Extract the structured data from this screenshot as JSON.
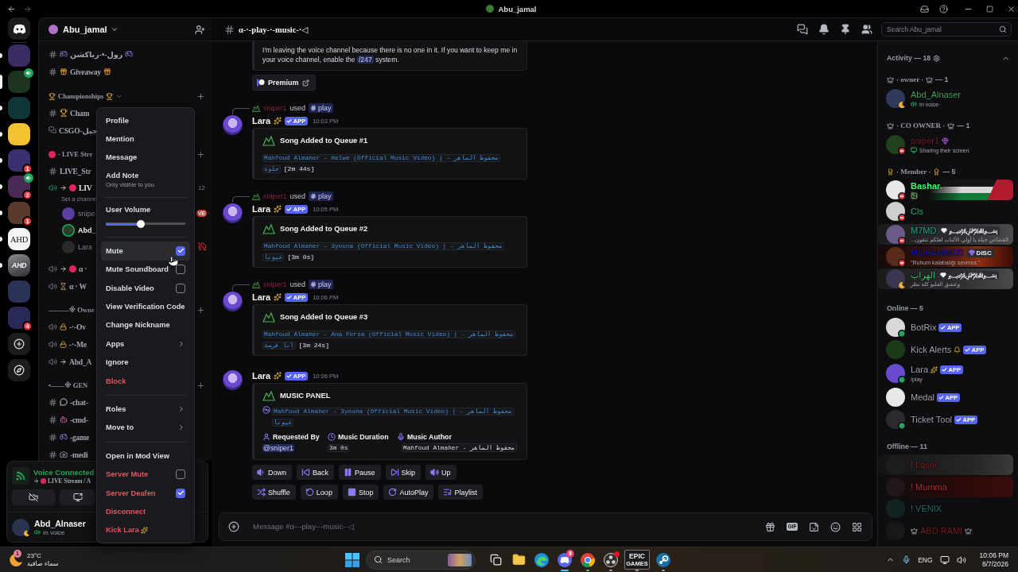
{
  "titlebar": {
    "title": "Abu_jamal"
  },
  "servers": [
    {
      "kind": "image",
      "selected": false,
      "unread": true
    },
    {
      "kind": "image",
      "selected": true,
      "voice": true
    },
    {
      "kind": "image",
      "selected": false,
      "unread": true
    },
    {
      "kind": "image",
      "selected": false,
      "unread": true
    },
    {
      "kind": "image",
      "selected": false,
      "unread": true,
      "badge": "1"
    },
    {
      "kind": "image",
      "selected": false,
      "unread": true,
      "badge": "2",
      "voice": true
    },
    {
      "kind": "image",
      "selected": false,
      "unread": true,
      "badge": "1"
    },
    {
      "kind": "text",
      "label": "AHD",
      "selected": false,
      "unread": true
    },
    {
      "kind": "logo",
      "label": "AHD",
      "selected": false,
      "unread": true
    },
    {
      "kind": "image",
      "selected": false,
      "unread": false
    },
    {
      "kind": "image",
      "selected": false,
      "unread": false,
      "badge": "4"
    },
    {
      "kind": "add",
      "selected": false,
      "unread": false
    },
    {
      "kind": "discover",
      "selected": false,
      "unread": false
    }
  ],
  "sidebar": {
    "server_name": "Abu_jamal",
    "channels": [
      {
        "kind": "text",
        "lead": [
          {
            "kind": "gamepad"
          }
        ],
        "name": "رول-•-رياكشن",
        "trail": [
          {
            "kind": "gamepad"
          }
        ]
      },
      {
        "kind": "text",
        "lead": [
          {
            "kind": "gift"
          }
        ],
        "name": "Giveaway",
        "trail": [
          {
            "kind": "gift"
          }
        ]
      },
      {
        "kind": "category",
        "lead": [
          {
            "kind": "trophy"
          }
        ],
        "name": "Championships",
        "trail": [
          {
            "kind": "trophy"
          }
        ],
        "chevron": true,
        "add": true
      },
      {
        "kind": "text",
        "lead": [
          {
            "kind": "trophy"
          }
        ],
        "name": "Cham"
      },
      {
        "kind": "thread",
        "name": "CSGO-جيل"
      },
      {
        "kind": "category",
        "lead": [
          {
            "kind": "red-dot"
          }
        ],
        "name": "· LIVE Stre",
        "add": true
      },
      {
        "kind": "text",
        "name": "LIVE_Str"
      },
      {
        "kind": "voice",
        "active": true,
        "lead": [
          {
            "kind": "arrow"
          },
          {
            "kind": "red-dot"
          }
        ],
        "name": "LIV",
        "limit": "12",
        "topic": "Set a channe"
      },
      {
        "kind": "user",
        "name": "snipe",
        "live": "VE",
        "speaking": false,
        "deafened": false
      },
      {
        "kind": "user",
        "name": "Abd_",
        "speaking": true,
        "deafened": false
      },
      {
        "kind": "user",
        "name": "Lara",
        "speaking": false,
        "deafened": true
      },
      {
        "kind": "voice",
        "active": false,
        "lead": [
          {
            "kind": "arrow"
          },
          {
            "kind": "red-dot"
          }
        ],
        "name": "α ·"
      },
      {
        "kind": "voice",
        "active": false,
        "lead": [
          {
            "kind": "hourglass"
          }
        ],
        "name": "α · W"
      },
      {
        "kind": "category",
        "name": "———※ Owne",
        "add": true
      },
      {
        "kind": "voice",
        "active": false,
        "lead": [
          {
            "kind": "lock"
          }
        ],
        "name": "-·-Ov"
      },
      {
        "kind": "voice",
        "active": false,
        "lead": [
          {
            "kind": "lock"
          }
        ],
        "name": "-·-Me"
      },
      {
        "kind": "voice",
        "active": false,
        "lead": [
          {
            "kind": "arrow"
          }
        ],
        "name": "Abd_A"
      },
      {
        "kind": "category",
        "name": "•——※ GEN",
        "add": true
      },
      {
        "kind": "text",
        "lead": [
          {
            "kind": "speech"
          }
        ],
        "name": "-chat-"
      },
      {
        "kind": "text",
        "lead": [
          {
            "kind": "robot"
          }
        ],
        "name": "-cmd-"
      },
      {
        "kind": "text",
        "lead": [
          {
            "kind": "gamepad"
          }
        ],
        "name": "-game"
      },
      {
        "kind": "text",
        "lead": [
          {
            "kind": "camera"
          }
        ],
        "name": "-medi"
      }
    ]
  },
  "voice_panel": {
    "status": "Voice Connected",
    "lead": [
      {
        "kind": "arrow"
      },
      {
        "kind": "red-dot"
      }
    ],
    "channel": "LIVE Stream / A"
  },
  "user_panel": {
    "name": "Abd_Alnaser",
    "status": {
      "kind": "idle"
    },
    "activity": "In voice"
  },
  "channel_header": {
    "name": "α-·-play-·-music-·◁"
  },
  "search": {
    "placeholder": "Search Abu_jamal"
  },
  "messages": [
    {
      "kind": "embed-tail",
      "before": "I'm leaving the voice channel because there is no one in it. If you want to keep me in your voice channel, enable the ",
      "command": "/247",
      "after": " system."
    },
    {
      "kind": "link-button",
      "label": "Premium"
    },
    {
      "kind": "bot",
      "reply": {
        "user": "sniper1",
        "verb": "used",
        "command": "play"
      },
      "author": "Lara",
      "trail": [
        {
          "kind": "sparkle"
        }
      ],
      "app": "APP",
      "time": "10:03 PM",
      "embed": {
        "kind": "queue",
        "title": "Song Added to Queue #1",
        "track": "Mahfoud Almaher - Helwe (Official Music Video) | محفوظ الماهر - حلوة",
        "duration": "[2m 44s]"
      }
    },
    {
      "kind": "bot",
      "reply": {
        "user": "sniper1",
        "verb": "used",
        "command": "play"
      },
      "author": "Lara",
      "trail": [
        {
          "kind": "sparkle"
        }
      ],
      "app": "APP",
      "time": "10:05 PM",
      "embed": {
        "kind": "queue",
        "title": "Song Added to Queue #2",
        "track": "Mahfoud Almaher - 3youna (Official Music Video) | محفوظ الماهر - عيونا",
        "duration": "[3m 0s]"
      }
    },
    {
      "kind": "bot",
      "reply": {
        "user": "sniper1",
        "verb": "used",
        "command": "play"
      },
      "author": "Lara",
      "trail": [
        {
          "kind": "sparkle"
        }
      ],
      "app": "APP",
      "time": "10:06 PM",
      "embed": {
        "kind": "queue",
        "title": "Song Added to Queue #3",
        "track": "Mahfoud Almaher - Ana Forsa (Official Music Video) | محفوظ الماهر - انا فرصة",
        "duration": "[3m 24s]"
      }
    },
    {
      "kind": "bot",
      "author": "Lara",
      "trail": [
        {
          "kind": "sparkle"
        }
      ],
      "app": "APP",
      "time": "10:06 PM",
      "embed": {
        "kind": "panel",
        "title": "MUSIC PANEL",
        "track": "Mahfoud Almaher - 3youna (Official Music Video) | محفوظ الماهر - عيونا",
        "fields": [
          {
            "kind": "mention",
            "name": "Requested By",
            "value": "@sniper1"
          },
          {
            "kind": "code",
            "name": "Music Duration",
            "value": "3m 0s"
          },
          {
            "kind": "code",
            "name": "Music Author",
            "value": "Mahfoud Almaher - محفوظ الماهر"
          }
        ]
      },
      "buttons": [
        [
          {
            "kind": "down",
            "label": "Down"
          },
          {
            "kind": "back",
            "label": "Back"
          },
          {
            "kind": "pause",
            "label": "Pause"
          },
          {
            "kind": "skip",
            "label": "Skip"
          },
          {
            "kind": "up",
            "label": "Up"
          }
        ],
        [
          {
            "kind": "shuffle",
            "label": "Shuffle"
          },
          {
            "kind": "loop",
            "label": "Loop"
          },
          {
            "kind": "stop",
            "label": "Stop"
          },
          {
            "kind": "autoplay",
            "label": "AutoPlay"
          },
          {
            "kind": "playlist",
            "label": "Playlist"
          }
        ]
      ]
    }
  ],
  "composer": {
    "placeholder": "Message #α-·-play-·-music-·◁",
    "gif": "GIF"
  },
  "members": {
    "activity": {
      "title": "Activity — 18"
    },
    "groups": [
      {
        "kind": "role",
        "title": "· owner ·",
        "count": "— 1",
        "icon": {
          "kind": "crown"
        },
        "members": [
          {
            "name": "Abd_Alnaser",
            "color": "#3ba55c",
            "status": {
              "kind": "idle"
            },
            "activity": {
              "kind": "voice",
              "text": "In voice"
            }
          }
        ]
      },
      {
        "kind": "role",
        "title": "· CO OWNER ·",
        "count": "— 1",
        "icon": {
          "kind": "crown"
        },
        "members": [
          {
            "name": "sniper1",
            "color": "#7a1d3a",
            "status": {
              "kind": "dnd"
            },
            "trail": [
              {
                "kind": "gem"
              }
            ],
            "activity": {
              "kind": "screen",
              "text": "Sharing their screen"
            }
          }
        ]
      },
      {
        "kind": "role",
        "title": "· Member ·",
        "count": "— 5",
        "icon": {
          "kind": "medal"
        },
        "members": [
          {
            "name": "Bashar.",
            "color": "#3cff6e",
            "status": {
              "kind": "dnd"
            },
            "bold": true,
            "activity": {
              "kind": "image"
            },
            "plate": {
              "kind": "flag"
            }
          },
          {
            "name": "Cls",
            "color": "#2fae6f",
            "status": {
              "kind": "dnd"
            }
          },
          {
            "name": "M7MD",
            "color": "#1fae8a",
            "status": {
              "kind": "dnd"
            },
            "tag": {
              "kind": "heart",
              "text": "﷽"
            },
            "activity": {
              "kind": "text",
              "text": "...القصاص حياة يا أولي الألباب لعلكم تتقون"
            },
            "plate": {
              "kind": "smoke"
            }
          },
          {
            "name": "MOHAMMED",
            "color": "#1c1cb8",
            "status": {
              "kind": "dnd"
            },
            "tag": {
              "kind": "gem",
              "text": "DISC"
            },
            "activity": {
              "kind": "text",
              "text": "\"Ruhum kalabalığı sevmez.\""
            },
            "plate": {
              "kind": "ember"
            }
          },
          {
            "name": "الهراب",
            "color": "#2ecc71",
            "status": {
              "kind": "idle"
            },
            "tag": {
              "kind": "heart",
              "text": "﷽"
            },
            "activity": {
              "kind": "text",
              "text": "وعشق القلبو كلة نظر"
            },
            "plate": {
              "kind": "smoke"
            }
          }
        ]
      },
      {
        "kind": "plain",
        "title": "Online — 5",
        "members": [
          {
            "name": "BotRix",
            "color": "#a0a5ad",
            "status": {
              "kind": "online"
            },
            "app": "APP"
          },
          {
            "name": "Kick Alerts",
            "color": "#a0a5ad",
            "trail": [
              {
                "kind": "bell"
              }
            ],
            "app": "APP"
          },
          {
            "name": "Lara",
            "color": "#a0a5ad",
            "status": {
              "kind": "online"
            },
            "trail": [
              {
                "kind": "sparkle"
              }
            ],
            "app": "APP",
            "activity": {
              "kind": "text",
              "text": "/play"
            }
          },
          {
            "name": "Medal",
            "color": "#a0a5ad",
            "app": "APP"
          },
          {
            "name": "Ticket Tool",
            "color": "#a0a5ad",
            "status": {
              "kind": "online"
            },
            "app": "APP"
          }
        ]
      },
      {
        "kind": "plain",
        "title": "Offline — 11",
        "members": [
          {
            "name": "! Laser",
            "color": "#8c2222",
            "offline": true,
            "plate": {
              "kind": "stone"
            }
          },
          {
            "name": "! Mumma",
            "color": "#b03030",
            "offline": true,
            "plate": {
              "kind": "blood"
            }
          },
          {
            "name": "! VENIX",
            "color": "#2a706a",
            "offline": true
          },
          {
            "name": "ABD RAMI",
            "color": "#7a1e1e",
            "offline": true,
            "lead": [
              {
                "kind": "crown"
              }
            ],
            "trail": [
              {
                "kind": "crown"
              }
            ]
          }
        ]
      }
    ]
  },
  "context_menu": {
    "items": [
      {
        "kind": "item",
        "label": "Profile",
        "danger": false,
        "highlighted": false
      },
      {
        "kind": "item",
        "label": "Mention",
        "danger": false,
        "highlighted": false
      },
      {
        "kind": "item",
        "label": "Message",
        "danger": false,
        "highlighted": false
      },
      {
        "kind": "item",
        "label": "Add Note",
        "hint": "Only visible to you",
        "danger": false,
        "highlighted": false
      },
      {
        "kind": "separator"
      },
      {
        "kind": "slider",
        "label": "User Volume",
        "level": 0.44
      },
      {
        "kind": "separator"
      },
      {
        "kind": "check",
        "label": "Mute",
        "checked": true,
        "danger": false,
        "highlighted": true
      },
      {
        "kind": "check",
        "label": "Mute Soundboard",
        "checked": false,
        "danger": false,
        "highlighted": false
      },
      {
        "kind": "check",
        "label": "Disable Video",
        "checked": false,
        "danger": false,
        "highlighted": false
      },
      {
        "kind": "item",
        "label": "View Verification Code",
        "danger": false,
        "highlighted": false
      },
      {
        "kind": "item",
        "label": "Change Nickname",
        "danger": false,
        "highlighted": false
      },
      {
        "kind": "submenu",
        "label": "Apps",
        "danger": false,
        "highlighted": false
      },
      {
        "kind": "item",
        "label": "Ignore",
        "danger": false,
        "highlighted": false
      },
      {
        "kind": "item",
        "label": "Block",
        "danger": true,
        "highlighted": false
      },
      {
        "kind": "separator"
      },
      {
        "kind": "submenu",
        "label": "Roles",
        "danger": false,
        "highlighted": false
      },
      {
        "kind": "submenu",
        "label": "Move to",
        "danger": false,
        "highlighted": false
      },
      {
        "kind": "separator"
      },
      {
        "kind": "item",
        "label": "Open in Mod View",
        "danger": false,
        "highlighted": false
      },
      {
        "kind": "check",
        "label": "Server Mute",
        "checked": false,
        "danger": true,
        "highlighted": false
      },
      {
        "kind": "check",
        "label": "Server Deafen",
        "checked": true,
        "danger": true,
        "highlighted": false
      },
      {
        "kind": "item",
        "label": "Disconnect",
        "danger": true,
        "highlighted": false
      },
      {
        "kind": "item",
        "label": "Kick Lara",
        "trail": [
          {
            "kind": "sparkle"
          }
        ],
        "danger": true,
        "highlighted": false
      }
    ]
  },
  "taskbar": {
    "weather": {
      "badge": "1",
      "temp": "23°C",
      "desc": "سماء صافية"
    },
    "search": "Search",
    "apps": [
      {
        "kind": "discord",
        "badge": "8",
        "running": true,
        "active": true
      },
      {
        "kind": "chrome",
        "running": true,
        "active": false
      },
      {
        "kind": "obs",
        "alert": true,
        "running": true,
        "active": false
      },
      {
        "kind": "epic",
        "label": "EPIC",
        "sub": "GAMES",
        "running": true,
        "active": false
      },
      {
        "kind": "steam",
        "running": true,
        "active": false
      }
    ],
    "lang": "ENG",
    "time": "10:06 PM",
    "date": "8/7/2026"
  }
}
